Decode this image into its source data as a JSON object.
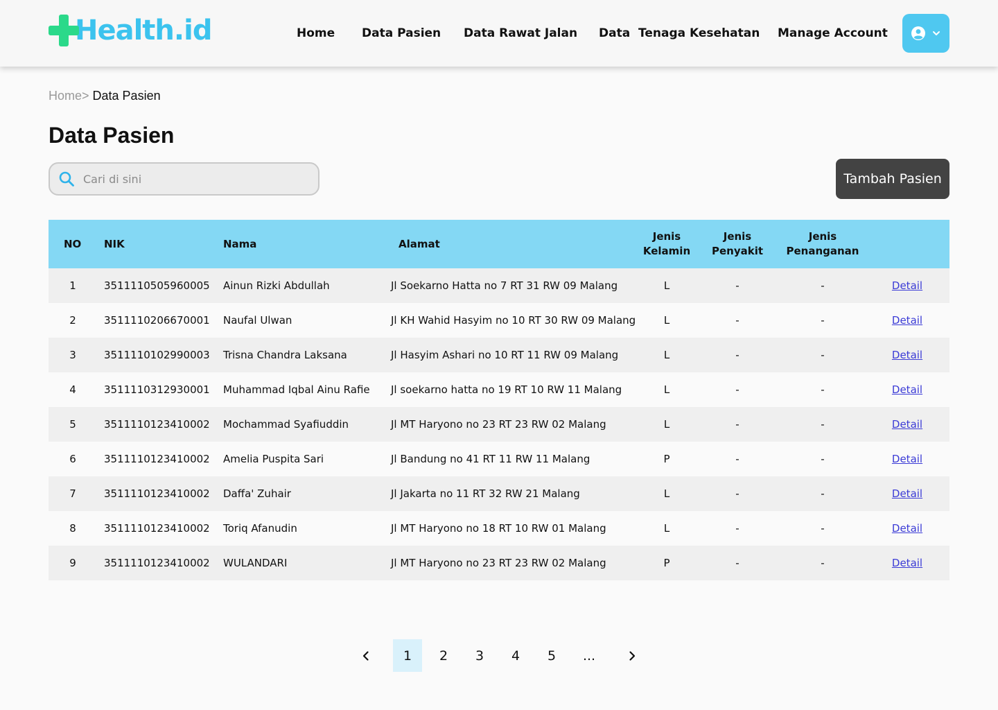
{
  "brand": {
    "logo_text": "Health.id"
  },
  "nav": {
    "items": [
      "Home",
      "Data Pasien",
      "Data Rawat Jalan",
      "Data  Tenaga Kesehatan",
      "Manage Account"
    ],
    "account_icon": "user-circle-icon",
    "dropdown_icon": "chevron-down-icon"
  },
  "breadcrumb": {
    "home": "Home",
    "separator": ">",
    "current": " Data Pasien"
  },
  "page_title": "Data Pasien",
  "search": {
    "placeholder": "Cari di sini",
    "value": "",
    "icon": "search-icon"
  },
  "add_button": {
    "label": "Tambah Pasien"
  },
  "table": {
    "headers": {
      "no": "NO",
      "nik": "NIK",
      "nama": "Nama",
      "alamat": "Alamat",
      "jenis_kelamin_1": "Jenis",
      "jenis_kelamin_2": "Kelamin",
      "jenis_penyakit_1": "Jenis",
      "jenis_penyakit_2": "Penyakit",
      "jenis_penanganan_1": "Jenis",
      "jenis_penanganan_2": "Penanganan"
    },
    "rows": [
      {
        "no": "1",
        "nik": "3511110505960005",
        "nama": "Ainun Rizki Abdullah",
        "alamat": "Jl Soekarno Hatta no 7 RT 31 RW 09 Malang",
        "jk": "L",
        "penyakit": "-",
        "penanganan": "-",
        "action": "Detail"
      },
      {
        "no": "2",
        "nik": "3511110206670001",
        "nama": "Naufal Ulwan",
        "alamat": "Jl KH Wahid Hasyim no 10 RT 30 RW 09 Malang",
        "jk": "L",
        "penyakit": "-",
        "penanganan": "-",
        "action": "Detail"
      },
      {
        "no": "3",
        "nik": "3511110102990003",
        "nama": "Trisna Chandra Laksana",
        "alamat": "Jl Hasyim Ashari no 10 RT 11 RW 09 Malang",
        "jk": "L",
        "penyakit": "-",
        "penanganan": "-",
        "action": "Detail"
      },
      {
        "no": "4",
        "nik": "3511110312930001",
        "nama": "Muhammad Iqbal Ainu Rafie",
        "alamat": "Jl soekarno hatta no 19 RT 10 RW 11 Malang",
        "jk": "L",
        "penyakit": "-",
        "penanganan": "-",
        "action": "Detail"
      },
      {
        "no": "5",
        "nik": "3511110123410002",
        "nama": "Mochammad Syafiuddin",
        "alamat": "Jl MT Haryono no 23 RT 23 RW 02 Malang",
        "jk": "L",
        "penyakit": "-",
        "penanganan": "-",
        "action": "Detail"
      },
      {
        "no": "6",
        "nik": "3511110123410002",
        "nama": "Amelia Puspita Sari",
        "alamat": "Jl Bandung no 41 RT 11 RW 11 Malang",
        "jk": "P",
        "penyakit": "-",
        "penanganan": "-",
        "action": "Detail"
      },
      {
        "no": "7",
        "nik": "3511110123410002",
        "nama": "Daffa' Zuhair",
        "alamat": "Jl Jakarta no 11 RT 32 RW 21 Malang",
        "jk": "L",
        "penyakit": "-",
        "penanganan": "-",
        "action": "Detail"
      },
      {
        "no": "8",
        "nik": "3511110123410002",
        "nama": "Toriq Afanudin",
        "alamat": "Jl MT Haryono no 18 RT 10 RW 01 Malang",
        "jk": "L",
        "penyakit": "-",
        "penanganan": "-",
        "action": "Detail"
      },
      {
        "no": "9",
        "nik": "3511110123410002",
        "nama": "WULANDARI",
        "alamat": "Jl MT Haryono no 23 RT 23 RW 02 Malang",
        "jk": "P",
        "penyakit": "-",
        "penanganan": "-",
        "action": "Detail"
      }
    ]
  },
  "pagination": {
    "prev_icon": "chevron-left-icon",
    "next_icon": "chevron-right-icon",
    "pages": [
      "1",
      "2",
      "3",
      "4",
      "5",
      "..."
    ],
    "active": "1"
  },
  "colors": {
    "brand_cross": "#2bd98a",
    "brand_text": "#3cc3ee",
    "table_header": "#84d8f4",
    "account_button": "#4fc8f0",
    "add_button": "#434343",
    "active_page": "#d9f1fb",
    "link": "#3b3bd6"
  }
}
